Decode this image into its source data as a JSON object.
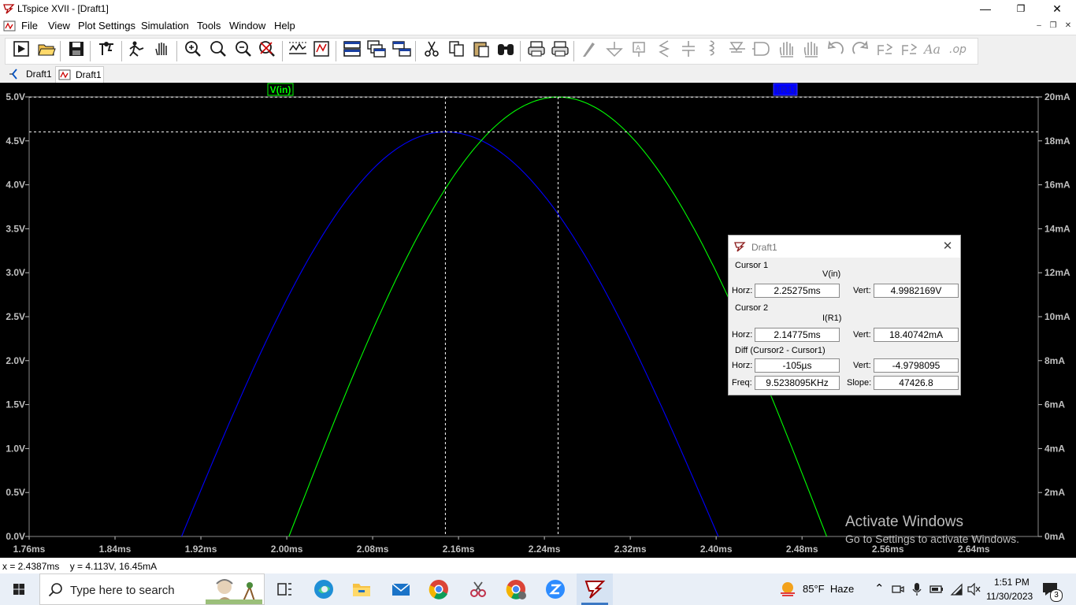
{
  "window": {
    "title": "LTspice XVII - [Draft1]",
    "minimize": "—",
    "maximize": "❐",
    "close": "✕"
  },
  "menu": {
    "items": [
      "File",
      "View",
      "Plot Settings",
      "Simulation",
      "Tools",
      "Window",
      "Help"
    ],
    "mdi_minimize": "–",
    "mdi_restore": "❐",
    "mdi_close": "✕"
  },
  "toolbar": {
    "buttons": [
      "run",
      "open",
      "save",
      "control-panel",
      "halt",
      "pan",
      "zoom-in",
      "zoom-back",
      "zoom-out",
      "zoom-fit",
      "autorange-y",
      "manual-limits",
      "tile-horizontally",
      "cascade",
      "tile-vertically",
      "cut",
      "copy",
      "paste",
      "find",
      "print",
      "print-setup",
      "draw-wire",
      "ground",
      "label-net",
      "resistor",
      "capacitor",
      "inductor",
      "diode",
      "component",
      "move",
      "drag",
      "undo",
      "redo",
      "rotate",
      "mirror",
      "text",
      "spice-directive"
    ]
  },
  "tabs": [
    {
      "label": "Draft1",
      "icon": "schematic-icon"
    },
    {
      "label": "Draft1",
      "icon": "waveform-icon",
      "active": true
    }
  ],
  "plot": {
    "trace_labels": {
      "v_in": "V(in)",
      "i_r1": "I(R1)"
    },
    "colors": {
      "v_in": "#00ff00",
      "i_r1": "#0000ff",
      "grid": "#c0c0c0",
      "background": "#000000"
    },
    "left_axis_ticks": [
      "5.0V",
      "4.5V",
      "4.0V",
      "3.5V",
      "3.0V",
      "2.5V",
      "2.0V",
      "1.5V",
      "1.0V",
      "0.5V",
      "0.0V"
    ],
    "right_axis_ticks": [
      "20mA",
      "18mA",
      "16mA",
      "14mA",
      "12mA",
      "10mA",
      "8mA",
      "6mA",
      "4mA",
      "2mA",
      "0mA"
    ],
    "x_axis_ticks": [
      "1.76ms",
      "1.84ms",
      "1.92ms",
      "2.00ms",
      "2.08ms",
      "2.16ms",
      "2.24ms",
      "2.32ms",
      "2.40ms",
      "2.48ms",
      "2.56ms",
      "2.64ms"
    ]
  },
  "chart_data": {
    "type": "line",
    "xlabel": "",
    "ylabel": "",
    "xlim_ms": [
      1.76,
      2.7
    ],
    "ylim_left_V": [
      0,
      5
    ],
    "ylim_right_mA": [
      0,
      20
    ],
    "series": [
      {
        "name": "V(in)",
        "axis": "left",
        "unit": "V",
        "x_ms": [
          2.002,
          2.05,
          2.1,
          2.15,
          2.2,
          2.25275,
          2.3,
          2.35,
          2.4,
          2.45,
          2.503
        ],
        "y": [
          0.0,
          1.48,
          2.91,
          3.9,
          4.61,
          4.998,
          4.64,
          3.98,
          2.96,
          1.6,
          0.0
        ]
      },
      {
        "name": "I(R1)",
        "axis": "right",
        "unit": "mA",
        "x_ms": [
          1.902,
          1.95,
          2.0,
          2.05,
          2.1,
          2.14775,
          2.2,
          2.25,
          2.3,
          2.35,
          2.4,
          2.402
        ],
        "y": [
          0.0,
          5.7,
          10.98,
          14.93,
          17.52,
          18.407,
          17.6,
          14.88,
          11.05,
          6.1,
          0.2,
          0.0
        ]
      }
    ],
    "cursors": [
      {
        "x_ms": 2.25275,
        "y": 4.9982169,
        "trace": "V(in)"
      },
      {
        "x_ms": 2.14775,
        "y": 18.40742,
        "trace": "I(R1)"
      }
    ]
  },
  "cursor_dialog": {
    "title": "Draft1",
    "cursor1": {
      "heading": "Cursor 1",
      "trace": "V(in)",
      "horz_label": "Horz:",
      "horz": "2.25275ms",
      "vert_label": "Vert:",
      "vert": "4.9982169V"
    },
    "cursor2": {
      "heading": "Cursor 2",
      "trace": "I(R1)",
      "horz_label": "Horz:",
      "horz": "2.14775ms",
      "vert_label": "Vert:",
      "vert": "18.40742mA"
    },
    "diff": {
      "heading": "Diff (Cursor2 - Cursor1)",
      "horz_label": "Horz:",
      "horz": "-105µs",
      "vert_label": "Vert:",
      "vert": "-4.9798095",
      "freq_label": "Freq:",
      "freq": "9.5238095KHz",
      "slope_label": "Slope:",
      "slope": "47426.8"
    }
  },
  "status": {
    "text": "x = 2.4387ms    y = 4.113V, 16.45mA"
  },
  "activation": {
    "line1": "Activate Windows",
    "line2": "Go to Settings to activate Windows."
  },
  "taskbar": {
    "search_placeholder": "Type here to search",
    "apps": [
      "task-view",
      "edge",
      "file-explorer",
      "mail",
      "chrome",
      "snipping-tool",
      "chrome-profile",
      "zoom",
      "ltspice"
    ],
    "weather": "85°F  Haze",
    "time": "1:51 PM",
    "date": "11/30/2023",
    "notifications": "3"
  }
}
